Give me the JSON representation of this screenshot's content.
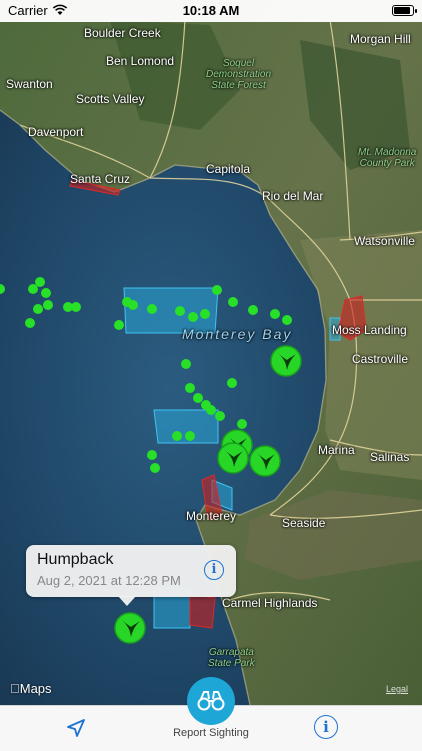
{
  "status_bar": {
    "carrier": "Carrier",
    "time": "10:18 AM",
    "battery_level": 0.9
  },
  "map": {
    "places": [
      {
        "id": "boulder-creek",
        "label": "Boulder Creek"
      },
      {
        "id": "ben-lomond",
        "label": "Ben Lomond"
      },
      {
        "id": "swanton",
        "label": "Swanton"
      },
      {
        "id": "scotts-valley",
        "label": "Scotts Valley"
      },
      {
        "id": "davenport",
        "label": "Davenport"
      },
      {
        "id": "santa-cruz",
        "label": "Santa Cruz"
      },
      {
        "id": "capitola",
        "label": "Capitola"
      },
      {
        "id": "rio-del-mar",
        "label": "Rio del Mar"
      },
      {
        "id": "morgan-hill",
        "label": "Morgan Hill"
      },
      {
        "id": "watsonville",
        "label": "Watsonville"
      },
      {
        "id": "moss-landing",
        "label": "Moss Landing"
      },
      {
        "id": "castroville",
        "label": "Castroville"
      },
      {
        "id": "marina",
        "label": "Marina"
      },
      {
        "id": "salinas",
        "label": "Salinas"
      },
      {
        "id": "monterey",
        "label": "Monterey"
      },
      {
        "id": "seaside",
        "label": "Seaside"
      },
      {
        "id": "carmel-highlands",
        "label": "Carmel Highlands"
      }
    ],
    "parks": [
      {
        "id": "soquel",
        "line1": "Soquel",
        "line2": "Demonstration",
        "line3": "State Forest"
      },
      {
        "id": "mt-madonna",
        "line1": "Mt. Madonna",
        "line2": "County Park"
      },
      {
        "id": "garrapata",
        "line1": "Garrapata",
        "line2": "State Park"
      }
    ],
    "water_label": "Monterey Bay",
    "attribution": "Maps",
    "legal": "Legal"
  },
  "callout": {
    "title": "Humpback",
    "subtitle": "Aug 2, 2021 at 12:28 PM"
  },
  "tab_bar": {
    "report_label": "Report Sighting"
  },
  "colors": {
    "accent": "#1ea6d6",
    "sighting": "#27e027",
    "zone_fill": "#2aa6d6",
    "restricted": "#cc2020"
  },
  "icons": {
    "locate": "location-arrow-icon",
    "info": "info-icon",
    "report": "binoculars-icon",
    "whale": "whale-tail-icon"
  }
}
